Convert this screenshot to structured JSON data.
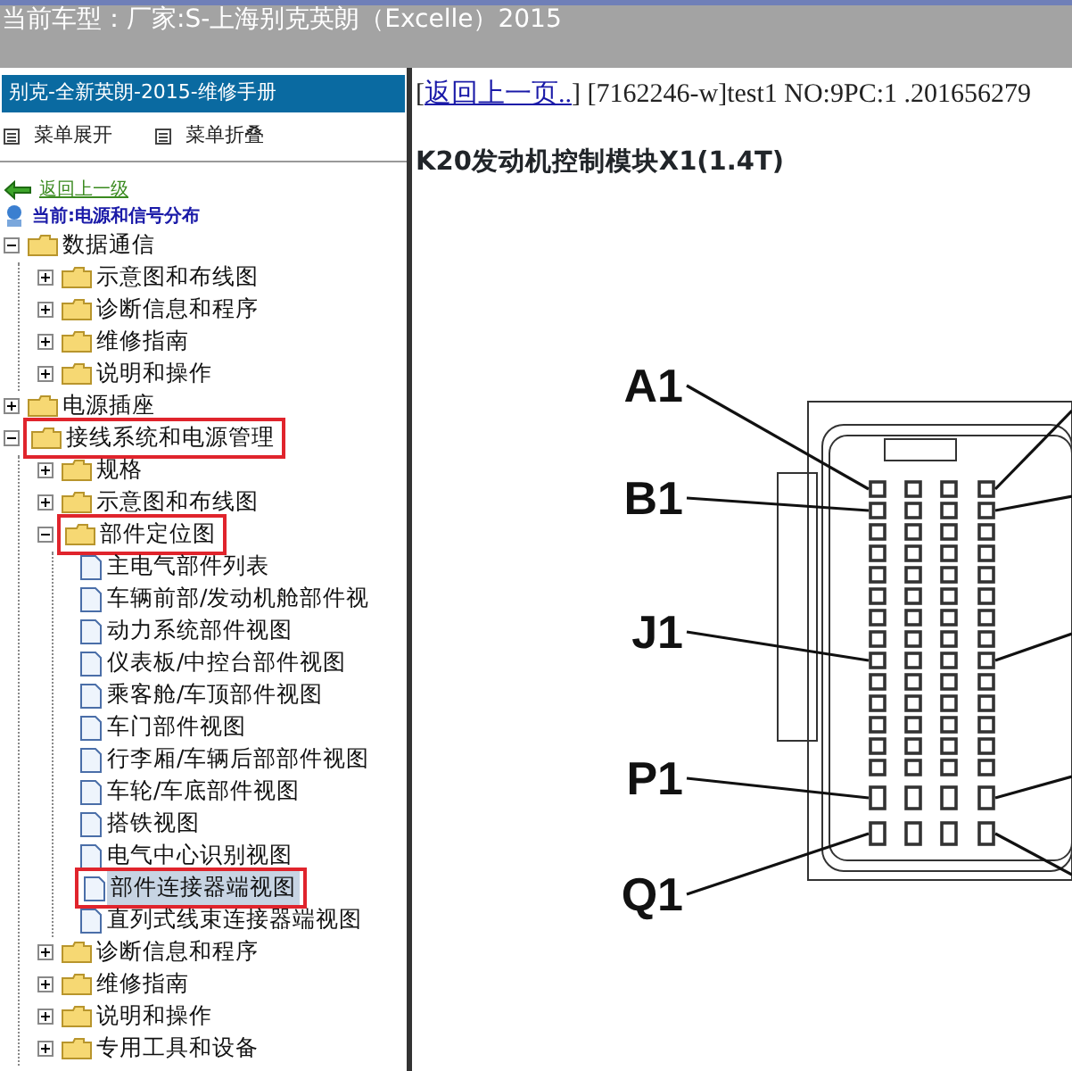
{
  "header": {
    "title": "当前车型：厂家:S-上海别克英朗（Excelle）2015"
  },
  "sidebar": {
    "title": "别克-全新英朗-2015-维修手册",
    "menu_buttons": [
      {
        "label": "菜单展开"
      },
      {
        "label": "菜单折叠"
      }
    ],
    "back_link": "返回上一级",
    "current": "当前:电源和信号分布",
    "tree": [
      {
        "kind": "folder",
        "label": "数据通信",
        "expanded": true,
        "highlighted": false,
        "children": [
          {
            "kind": "folder",
            "label": "示意图和布线图",
            "expanded": false,
            "highlighted": false
          },
          {
            "kind": "folder",
            "label": "诊断信息和程序",
            "expanded": false,
            "highlighted": false
          },
          {
            "kind": "folder",
            "label": "维修指南",
            "expanded": false,
            "highlighted": false
          },
          {
            "kind": "folder",
            "label": "说明和操作",
            "expanded": false,
            "highlighted": false
          }
        ]
      },
      {
        "kind": "folder",
        "label": "电源插座",
        "expanded": false,
        "highlighted": false
      },
      {
        "kind": "folder",
        "label": "接线系统和电源管理",
        "expanded": true,
        "highlighted": true,
        "children": [
          {
            "kind": "folder",
            "label": "规格",
            "expanded": false,
            "highlighted": false
          },
          {
            "kind": "folder",
            "label": "示意图和布线图",
            "expanded": false,
            "highlighted": false
          },
          {
            "kind": "folder",
            "label": "部件定位图",
            "expanded": true,
            "highlighted": true,
            "children": [
              {
                "kind": "document",
                "label": "主电气部件列表",
                "selected": false,
                "highlighted": false
              },
              {
                "kind": "document",
                "label": "车辆前部/发动机舱部件视",
                "selected": false,
                "highlighted": false
              },
              {
                "kind": "document",
                "label": "动力系统部件视图",
                "selected": false,
                "highlighted": false
              },
              {
                "kind": "document",
                "label": "仪表板/中控台部件视图",
                "selected": false,
                "highlighted": false
              },
              {
                "kind": "document",
                "label": "乘客舱/车顶部件视图",
                "selected": false,
                "highlighted": false
              },
              {
                "kind": "document",
                "label": "车门部件视图",
                "selected": false,
                "highlighted": false
              },
              {
                "kind": "document",
                "label": "行李厢/车辆后部部件视图",
                "selected": false,
                "highlighted": false
              },
              {
                "kind": "document",
                "label": "车轮/车底部件视图",
                "selected": false,
                "highlighted": false
              },
              {
                "kind": "document",
                "label": "搭铁视图",
                "selected": false,
                "highlighted": false
              },
              {
                "kind": "document",
                "label": "电气中心识别视图",
                "selected": false,
                "highlighted": false
              },
              {
                "kind": "document",
                "label": "部件连接器端视图",
                "selected": true,
                "highlighted": true
              },
              {
                "kind": "document",
                "label": "直列式线束连接器端视图",
                "selected": false,
                "highlighted": false
              }
            ]
          },
          {
            "kind": "folder",
            "label": "诊断信息和程序",
            "expanded": false,
            "highlighted": false
          },
          {
            "kind": "folder",
            "label": "维修指南",
            "expanded": false,
            "highlighted": false
          },
          {
            "kind": "folder",
            "label": "说明和操作",
            "expanded": false,
            "highlighted": false
          },
          {
            "kind": "folder",
            "label": "专用工具和设备",
            "expanded": false,
            "highlighted": false
          }
        ]
      }
    ]
  },
  "content": {
    "info_prefix": "[",
    "back_link": "返回上一页..",
    "info_suffix": "] [7162246-w]test1 NO:9PC:1 .201656279",
    "title": "K20发动机控制模块X1(1.4T)",
    "diagram": {
      "pin_labels": [
        "A1",
        "B1",
        "J1",
        "P1",
        "Q1"
      ]
    }
  }
}
